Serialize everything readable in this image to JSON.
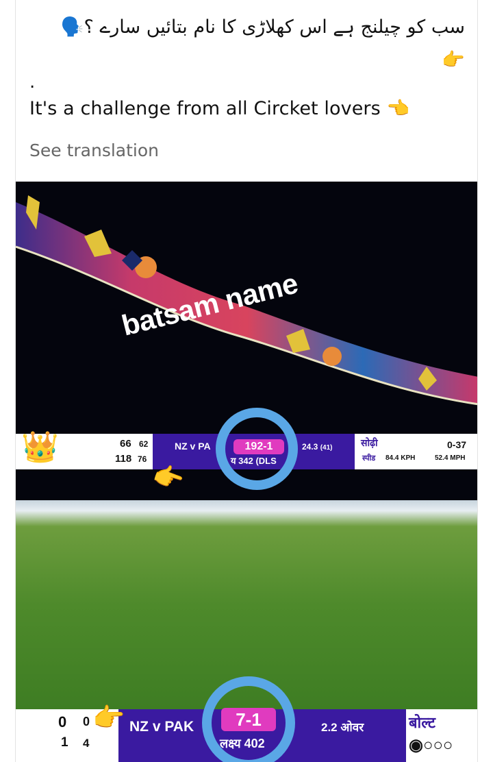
{
  "post": {
    "urdu_text": "سب کو چیلنج ہے اس کھلاڑی کا نام بتائیں سارے ؟🗣️",
    "urdu_emoji": "👉",
    "dot": ".",
    "english_text": "It's a challenge from all Circket lovers",
    "english_emoji": "👈",
    "see_translation": "See translation"
  },
  "image": {
    "overlay_text": "batsam name",
    "top_scoreboard": {
      "left_score_1": "66",
      "left_balls_1": "62",
      "left_score_2": "118",
      "left_balls_2": "76",
      "match": "NZ v PA",
      "score": "192-1",
      "target": "य 342 (DLS",
      "overs": "24.3",
      "overs_extra": "(41)",
      "bowler": "सोढ़ी",
      "bowler_figures": "0-37",
      "speed_label": "स्पीड",
      "speed_kph": "84.4 KPH",
      "speed_mph": "52.4 MPH"
    },
    "bottom_scoreboard": {
      "left_top_1": "0",
      "left_top_2": "0",
      "left_bottom_1": "1",
      "left_bottom_2": "4",
      "match": "NZ v PAK",
      "score": "7-1",
      "target": "लक्ष्य 402",
      "overs": "2.2 ओवर",
      "bowler": "बोल्ट",
      "balls_indicator": "◉○○○"
    },
    "crown_emoji": "👑",
    "pointing_emoji": "👉"
  }
}
